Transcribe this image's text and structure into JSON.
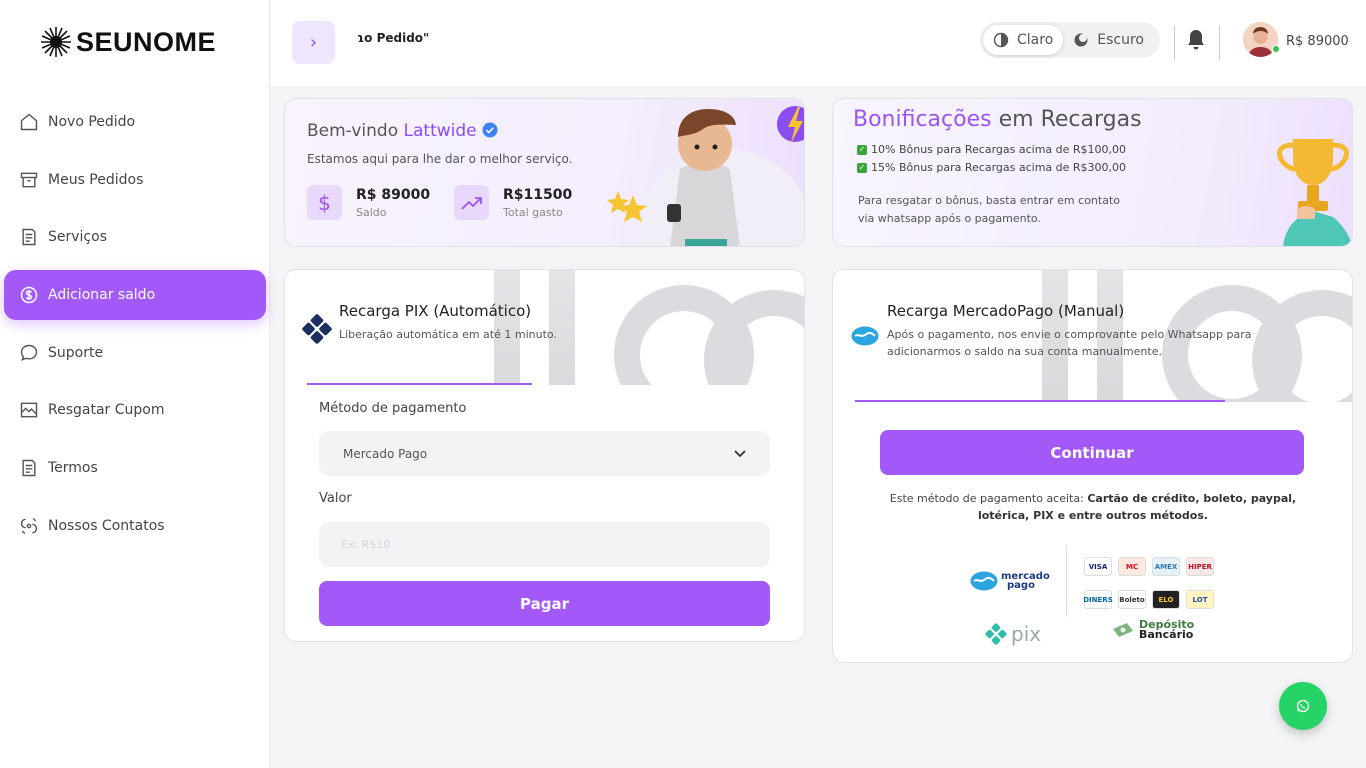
{
  "brand": {
    "name": "SEUNOME"
  },
  "sidebar": {
    "items": [
      {
        "label": "Novo Pedido",
        "icon": "home-icon"
      },
      {
        "label": "Meus Pedidos",
        "icon": "archive-icon"
      },
      {
        "label": "Serviços",
        "icon": "document-list-icon"
      },
      {
        "label": "Adicionar saldo",
        "icon": "dollar-circle-icon",
        "active": true
      },
      {
        "label": "Suporte",
        "icon": "chat-bubble-icon"
      },
      {
        "label": "Resgatar Cupom",
        "icon": "coupon-icon"
      },
      {
        "label": "Termos",
        "icon": "document-list-icon"
      },
      {
        "label": "Nossos Contatos",
        "icon": "contacts-icon"
      }
    ]
  },
  "header": {
    "breadcrumb": "ɿo Pedido\"",
    "theme": {
      "light": "Claro",
      "dark": "Escuro"
    },
    "balance": "R$ 89000"
  },
  "welcome": {
    "greeting": "Bem-vindo",
    "user": "Lattwide",
    "subtitle": "Estamos aqui para lhe dar o melhor serviço.",
    "balance_value": "R$ 89000",
    "balance_label": "Saldo",
    "spent_value": "R$11500",
    "spent_label": "Total gasto"
  },
  "bonus": {
    "title_highlight": "Bonificações",
    "title_rest": "em Recargas",
    "lines": [
      "10% Bônus para Recargas acima de R$100,00",
      "15% Bônus para Recargas acima de R$300,00"
    ],
    "note": "Para resgatar o bônus, basta entrar em contato via whatsapp após o pagamento."
  },
  "pix": {
    "title": "Recarga PIX (Automático)",
    "description": "Liberação automática em até 1 minuto.",
    "method_label": "Método de pagamento",
    "method_selected": "Mercado Pago",
    "value_label": "Valor",
    "value_placeholder": "Ex: R$10",
    "pay_button": "Pagar"
  },
  "mercadopago": {
    "title": "Recarga MercadoPago (Manual)",
    "description": "Após o pagamento, nos envie o comprovante pelo Whatsapp para adicionarmos o saldo na sua conta manualmente.",
    "continue_button": "Continuar",
    "accepts_prefix": "Este método de pagamento aceita:",
    "accepts_methods": "Cartão de crédito, boleto, paypal, lotérica, PIX e entre outros métodos.",
    "logo_mercado": "mercado",
    "logo_pago": "pago",
    "logo_pix": "pix",
    "logo_deposito": "Depósito",
    "logo_bancario": "Bancário",
    "cards": [
      "VISA",
      "MC",
      "AMEX",
      "HIPER",
      "DINERS",
      "Boleto",
      "ELO",
      "LOT"
    ]
  },
  "colors": {
    "accent": "#a259f7",
    "whatsapp": "#25d366"
  }
}
